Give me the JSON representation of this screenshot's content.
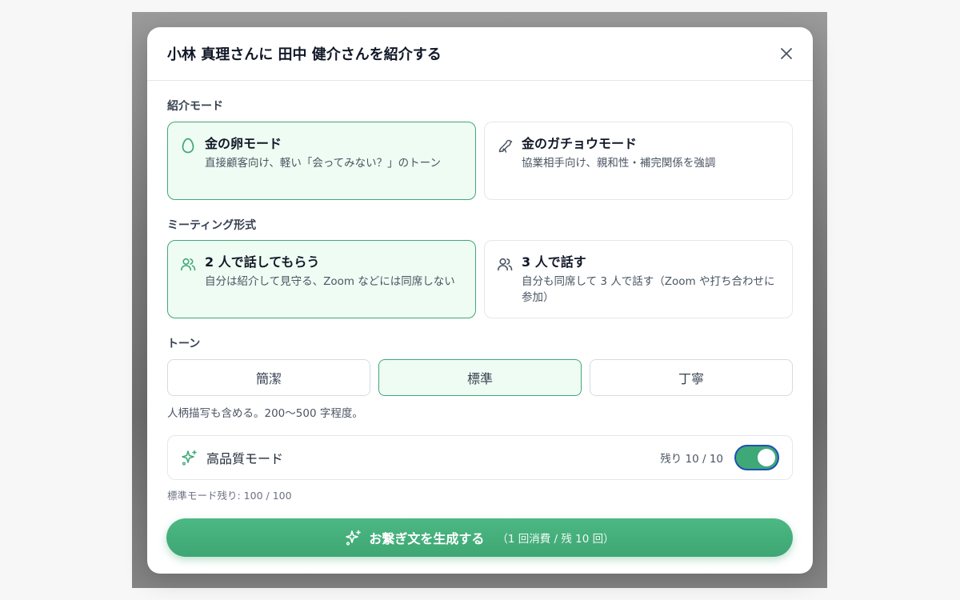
{
  "modal": {
    "title": "小林 真理さんに 田中 健介さんを紹介する",
    "close_icon": "close-icon"
  },
  "intro_mode": {
    "label": "紹介モード",
    "options": [
      {
        "title": "金の卵モード",
        "desc": "直接顧客向け、軽い「会ってみない？」のトーン",
        "icon": "egg-icon",
        "selected": true
      },
      {
        "title": "金のガチョウモード",
        "desc": "協業相手向け、親和性・補完関係を強調",
        "icon": "bird-icon",
        "selected": false
      }
    ]
  },
  "meeting_format": {
    "label": "ミーティング形式",
    "options": [
      {
        "title": "2 人で話してもらう",
        "desc": "自分は紹介して見守る、Zoom などには同席しない",
        "icon": "users-icon",
        "selected": true
      },
      {
        "title": "3 人で話す",
        "desc": "自分も同席して 3 人で話す（Zoom や打ち合わせに参加）",
        "icon": "users-icon",
        "selected": false
      }
    ]
  },
  "tone": {
    "label": "トーン",
    "options": [
      {
        "label": "簡潔",
        "selected": false
      },
      {
        "label": "標準",
        "selected": true
      },
      {
        "label": "丁寧",
        "selected": false
      }
    ],
    "note": "人柄描写も含める。200〜500 字程度。"
  },
  "quality_mode": {
    "label": "高品質モード",
    "remaining": "残り 10 / 10",
    "enabled": true,
    "icon": "sparkles-icon"
  },
  "standard_note": "標準モード残り: 100 / 100",
  "generate": {
    "label": "お繋ぎ文を生成する",
    "sub": "（1 回消費 / 残 10 回）",
    "icon": "sparkles-icon"
  },
  "colors": {
    "accent": "#3fa877",
    "selected_bg": "#effcf3",
    "toggle_border": "#1f4fb8"
  }
}
